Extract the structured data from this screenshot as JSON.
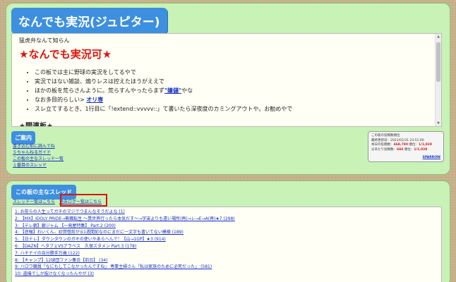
{
  "board": {
    "title": "なんでも実況(ジュピター)"
  },
  "rules": {
    "sub_line": "猛虎弁なんて知らん",
    "headline": "★なんでも実況可★",
    "items": [
      {
        "text": "この板では主に野球の実況をしてるやで"
      },
      {
        "text": "実況ではない雑談、煽りレスは控えたほうがええで"
      },
      {
        "text_before": "ほかの板を荒らさんように。荒らすんやったらまず",
        "link": "\"嫌儲\"",
        "text_after": "やな"
      },
      {
        "text_before": "なお多目的らしい> ",
        "link": "オリ専",
        "text_after": ""
      },
      {
        "text": "スレ立てするとき、1行目に「!extend::vvvvv::」て書いたら深夜度のカミングアウトや。お勧めやで"
      }
    ],
    "related_heading": "★関連板★"
  },
  "guide": {
    "badge": "ご案内",
    "links": [
      "書き込む前に読んでね",
      "５ちゃんねるガイド",
      "この板の主なスレッド一覧",
      "１番目のスレッド"
    ]
  },
  "stats": {
    "lines": [
      {
        "label": "この板の投稿数順位",
        "value": ""
      },
      {
        "label": "最終更新日：",
        "value": "2021/01/31 23:51:00"
      },
      {
        "label": "本日の投稿数：",
        "value": "468,780",
        "rank_label": " 順位：",
        "rank": "1/1,028"
      },
      {
        "label": "分あたり投稿数：",
        "value": "684",
        "rank_label": " 順位：",
        "rank": "1/1,028"
      }
    ],
    "sparrow": "SPARROW"
  },
  "threads": {
    "badge": "この板の主なスレッド",
    "list_all_label": "スレッド一覧はこちら",
    "past_log_label": "過去ログ一覧はこちら",
    "items": [
      "1: お前らの人生ってガチのマジでつまんなそうだよな (1)",
      "2: 【MX】IDOLY PRIDE→無職転生 ～異世界行ったら本気だす～→宇宙よりも遠い場所(再)→レ→E→A(再)★7 (298)",
      "3: 【テレ朝】銀ジャム 【一発屋特集】 Part.2 (200)",
      "4: 【悲報】わいくん、初貸借前が⑤1週間前なのにまだに一文字も書いてない模様 (189)",
      "5: 【日テレ】ダウンタウンのガキの使いやあらへんで！【山→1GP】★3 (914)",
      "6: 【DAZN】ヘタフェVSアラベス　久保スタメン Part.3 (178)",
      "7: ハチナイの自分勝手万歳 (122)",
      "8: 【キャンプ】12球団ファン集合【前日】 (34)",
      "9: ハロワ職員「なにもしてこなかったんですね」 専業主婦さん「私は家族のために必死だった」 (581)",
      "10: 盗撮でしか抜けなくなったんやが (3)"
    ]
  }
}
